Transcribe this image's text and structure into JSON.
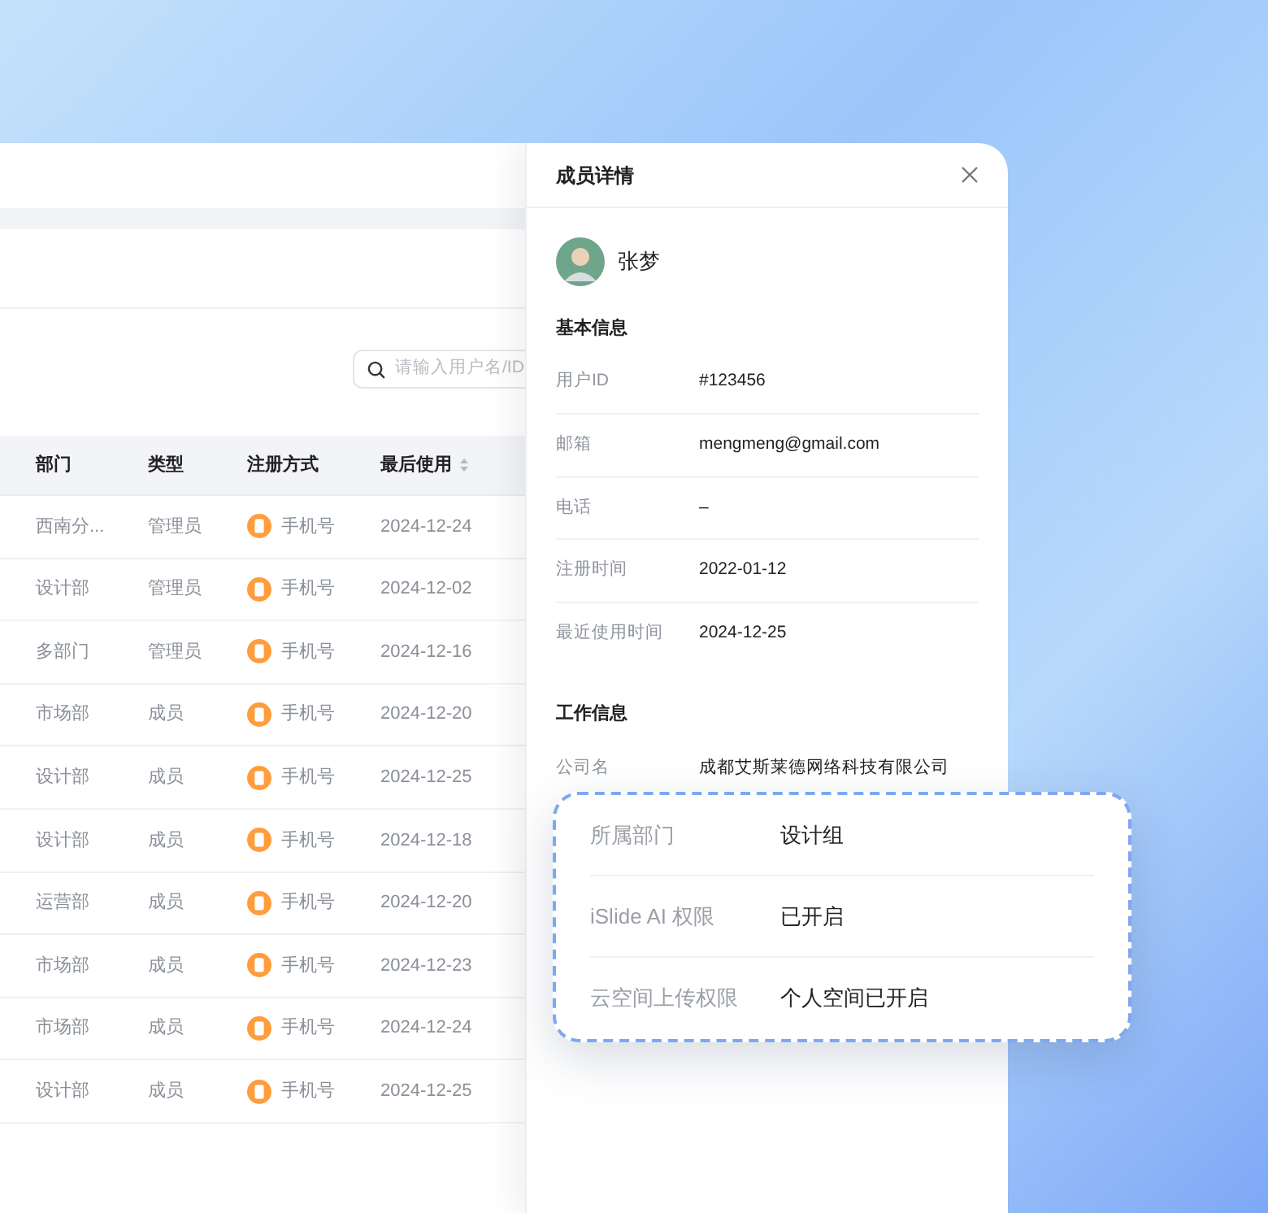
{
  "search": {
    "placeholder": "请输入用户名/ID"
  },
  "table": {
    "columns": [
      {
        "label": "部门",
        "sortable": false
      },
      {
        "label": "类型",
        "sortable": false
      },
      {
        "label": "注册方式",
        "sortable": false
      },
      {
        "label": "最后使用",
        "sortable": true
      }
    ],
    "rows": [
      {
        "dept": "西南分...",
        "type": "管理员",
        "method": "手机号",
        "last_used": "2024-12-24"
      },
      {
        "dept": "设计部",
        "type": "管理员",
        "method": "手机号",
        "last_used": "2024-12-02"
      },
      {
        "dept": "多部门",
        "type": "管理员",
        "method": "手机号",
        "last_used": "2024-12-16"
      },
      {
        "dept": "市场部",
        "type": "成员",
        "method": "手机号",
        "last_used": "2024-12-20"
      },
      {
        "dept": "设计部",
        "type": "成员",
        "method": "手机号",
        "last_used": "2024-12-25"
      },
      {
        "dept": "设计部",
        "type": "成员",
        "method": "手机号",
        "last_used": "2024-12-18"
      },
      {
        "dept": "运营部",
        "type": "成员",
        "method": "手机号",
        "last_used": "2024-12-20"
      },
      {
        "dept": "市场部",
        "type": "成员",
        "method": "手机号",
        "last_used": "2024-12-23"
      },
      {
        "dept": "市场部",
        "type": "成员",
        "method": "手机号",
        "last_used": "2024-12-24"
      },
      {
        "dept": "设计部",
        "type": "成员",
        "method": "手机号",
        "last_used": "2024-12-25"
      }
    ]
  },
  "drawer": {
    "title": "成员详情",
    "user": {
      "name": "张梦"
    },
    "sections": [
      {
        "title": "基本信息",
        "fields": [
          {
            "label": "用户ID",
            "value": "#123456"
          },
          {
            "label": "邮箱",
            "value": "mengmeng@gmail.com"
          },
          {
            "label": "电话",
            "value": "–"
          },
          {
            "label": "注册时间",
            "value": "2022-01-12"
          },
          {
            "label": "最近使用时间",
            "value": "2024-12-25"
          }
        ]
      },
      {
        "title": "工作信息",
        "fields": [
          {
            "label": "公司名",
            "value": "成都艾斯莱德网络科技有限公司"
          }
        ]
      }
    ]
  },
  "callout": {
    "fields": [
      {
        "label": "所属部门",
        "value": "设计组"
      },
      {
        "label": "iSlide AI 权限",
        "value": "已开启"
      },
      {
        "label": "云空间上传权限",
        "value": "个人空间已开启"
      }
    ]
  }
}
